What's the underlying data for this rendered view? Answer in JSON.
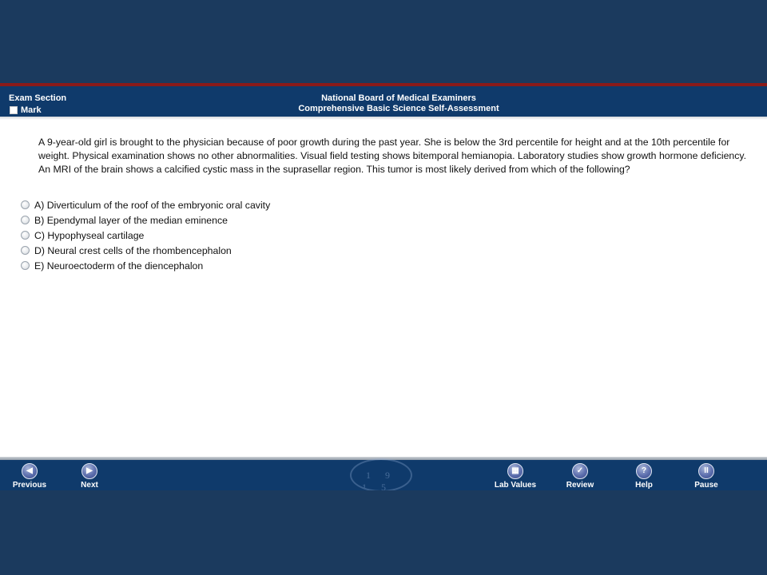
{
  "header": {
    "section_label": "Exam Section",
    "mark_label": "Mark",
    "title": "National Board of Medical Examiners",
    "subtitle": "Comprehensive Basic Science Self-Assessment"
  },
  "question": {
    "stem": "A 9-year-old girl is brought to the physician because of poor growth during the past year. She is below the 3rd percentile for height and at the 10th percentile for weight. Physical examination shows no other abnormalities. Visual field testing shows bitemporal hemianopia. Laboratory studies show growth hormone deficiency. An MRI of the brain shows a calcified cystic mass in the suprasellar region. This tumor is most likely derived from which of the following?",
    "answers": [
      "A) Diverticulum of the roof of the embryonic oral cavity",
      "B) Ependymal layer of the median eminence",
      "C) Hypophyseal cartilage",
      "D) Neural crest cells of the rhombencephalon",
      "E) Neuroectoderm of the diencephalon"
    ]
  },
  "footer": {
    "seal_text": "19 15",
    "buttons": {
      "previous": {
        "label": "Previous",
        "icon": "chevron-left-icon"
      },
      "next": {
        "label": "Next",
        "icon": "chevron-right-icon"
      },
      "lab_values": {
        "label": "Lab Values",
        "icon": "lab-values-icon"
      },
      "review": {
        "label": "Review",
        "icon": "checkmark-icon"
      },
      "help": {
        "label": "Help",
        "icon": "question-icon"
      },
      "pause": {
        "label": "Pause",
        "icon": "pause-icon"
      }
    }
  },
  "colors": {
    "outer_background": "#1b3a5e",
    "bar_background": "#0f3a6b",
    "accent_red": "#8b1a1a",
    "content_background": "#ffffff"
  }
}
